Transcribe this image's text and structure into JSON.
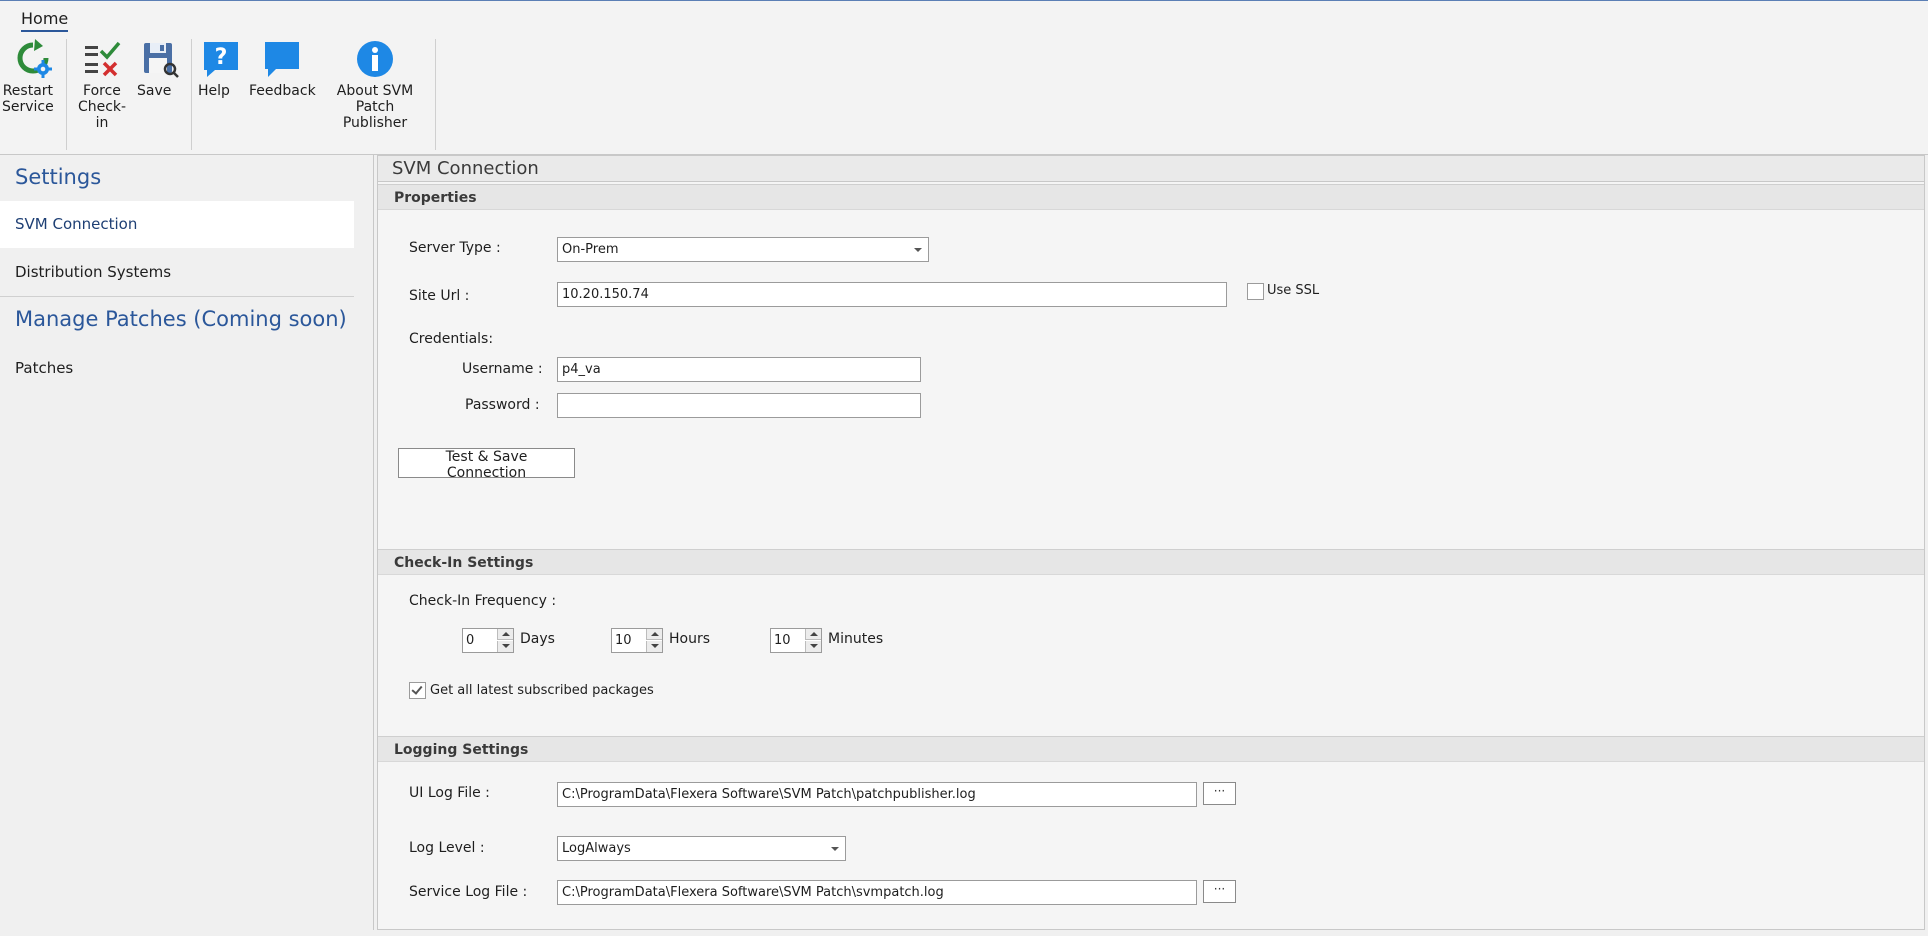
{
  "ribbon": {
    "tab": "Home",
    "buttons": {
      "restart": "Restart\nService",
      "force": "Force\nCheck-in",
      "save": "Save",
      "help": "Help",
      "feedback": "Feedback",
      "about": "About SVM Patch\nPublisher"
    }
  },
  "nav": {
    "settings_header": "Settings",
    "items": [
      "SVM Connection",
      "Distribution Systems"
    ],
    "manage_header": "Manage Patches (Coming soon)",
    "patches": "Patches",
    "selected": "SVM Connection"
  },
  "main": {
    "title": "SVM Connection",
    "properties": {
      "header": "Properties",
      "server_type_label": "Server Type :",
      "server_type_value": "On-Prem",
      "site_url_label": "Site Url :",
      "site_url_value": "10.20.150.74",
      "use_ssl_label": "Use SSL",
      "use_ssl_checked": false,
      "credentials_label": "Credentials:",
      "username_label": "Username :",
      "username_value": "p4_va",
      "password_label": "Password :",
      "password_value": "",
      "test_button": "Test & Save Connection"
    },
    "checkin": {
      "header": "Check-In Settings",
      "frequency_label": "Check-In Frequency :",
      "days_value": "0",
      "days_label": "Days",
      "hours_value": "10",
      "hours_label": "Hours",
      "minutes_value": "10",
      "minutes_label": "Minutes",
      "get_latest_label": "Get all latest subscribed packages",
      "get_latest_checked": true
    },
    "logging": {
      "header": "Logging Settings",
      "ui_log_label": "UI Log File :",
      "ui_log_value": "C:\\ProgramData\\Flexera Software\\SVM Patch\\patchpublisher.log",
      "log_level_label": "Log Level :",
      "log_level_value": "LogAlways",
      "service_log_label": "Service Log File :",
      "service_log_value": "C:\\ProgramData\\Flexera Software\\SVM Patch\\svmpatch.log",
      "browse_label": "···"
    }
  },
  "colors": {
    "accent": "#2b579a",
    "icon_blue": "#1e88e5",
    "icon_green": "#2e8b3a",
    "icon_red": "#d32f2f"
  }
}
